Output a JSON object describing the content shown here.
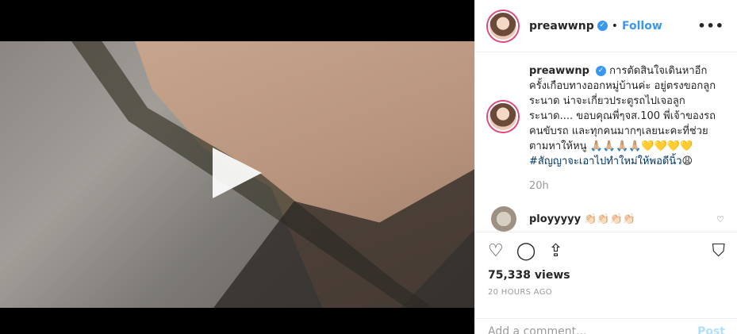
{
  "post": {
    "username": "preawwnp",
    "follow_label": "Follow",
    "more_label": "•••",
    "caption_username": "preawwnp",
    "caption_text": "การตัดสินใจเดินหาอีกครั้งเกือบทางออกหมู่บ้านค่ะ อยู่ตรงขอกลูกระนาด น่าจะเกี่ยวประตูรถไปเจอลูกระนาด.... ขอบคุณพี่ๆจส.100 พี่เจ้าของรถ คนขับรถ และทุกคนมากๆเลยนะคะที่ช่วยตามหาให้หนู 🙏🏼🙏🏼🙏🏼🙏🏼💛💛💛💛 ",
    "caption_hashtag": "#สัญญาจะเอาไปทำใหม่ให้พอดีนิ้ว",
    "caption_end": "😩",
    "caption_time": "20h",
    "reply_user": "ployyyyy",
    "reply_text": "👏🏻👏🏻👏🏻👏🏻",
    "views": "75,338 views",
    "time_ago": "20 HOURS AGO",
    "add_comment_placeholder": "Add a comment...",
    "post_label": "Post"
  },
  "icons": {
    "verified": "verified-badge-icon",
    "heart": "heart-icon",
    "comment": "comment-icon",
    "share": "share-icon",
    "bookmark": "bookmark-icon",
    "play": "play-icon"
  },
  "colors": {
    "link": "#3897f0",
    "hashtag": "#003569",
    "post_disabled": "#b2dffc"
  }
}
